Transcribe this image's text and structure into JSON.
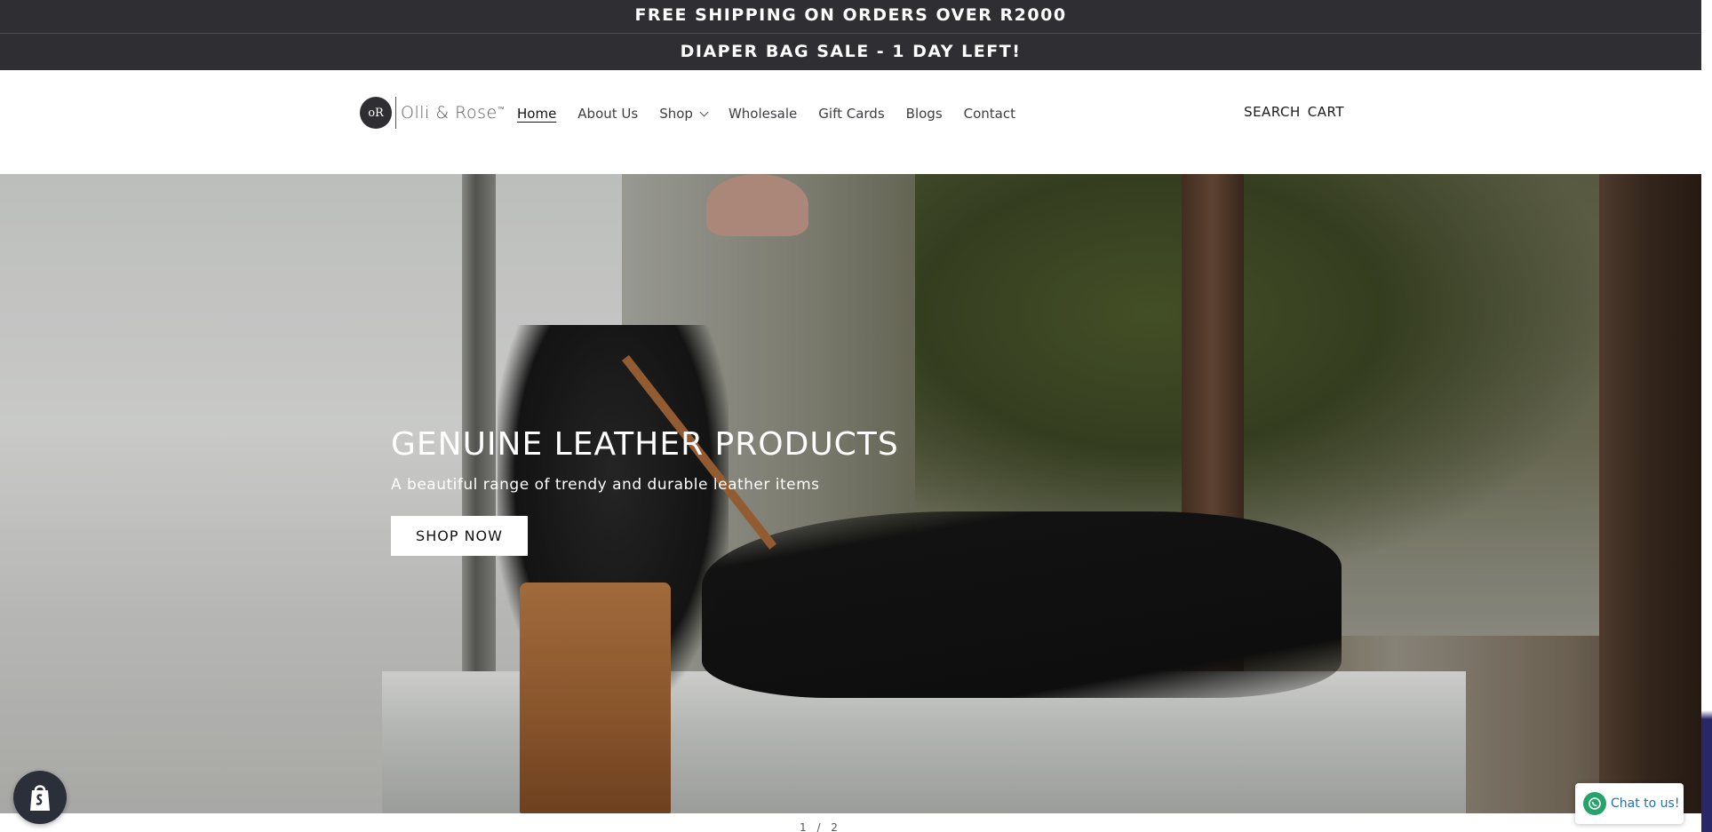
{
  "announcements": {
    "primary": "FREE SHIPPING ON ORDERS OVER R2000",
    "secondary": "DIAPER BAG SALE - 1 DAY LEFT!"
  },
  "header": {
    "logo": {
      "badge": "oR",
      "text": "Olli & Rose",
      "trademark": "™"
    },
    "nav": [
      {
        "label": "Home",
        "active": true
      },
      {
        "label": "About Us"
      },
      {
        "label": "Shop",
        "has_dropdown": true
      },
      {
        "label": "Wholesale"
      },
      {
        "label": "Gift Cards"
      },
      {
        "label": "Blogs"
      },
      {
        "label": "Contact"
      }
    ],
    "utility": {
      "search": "SEARCH",
      "cart": "CART"
    }
  },
  "hero": {
    "title": "GENUINE LEATHER PRODUCTS",
    "subtitle": "A beautiful range of trendy and durable leather items",
    "cta": "SHOP NOW",
    "slide_counter": "1 / 2"
  },
  "widgets": {
    "chat": "Chat to us!"
  },
  "colors": {
    "announcement_bg": "#2f2f33",
    "accent_chat": "#25a36a",
    "chat_text": "#1d6fb8",
    "page_edge": "#2a2768"
  },
  "icons": [
    "shopify-bag-icon",
    "whatsapp-icon",
    "chevron-down-icon"
  ]
}
